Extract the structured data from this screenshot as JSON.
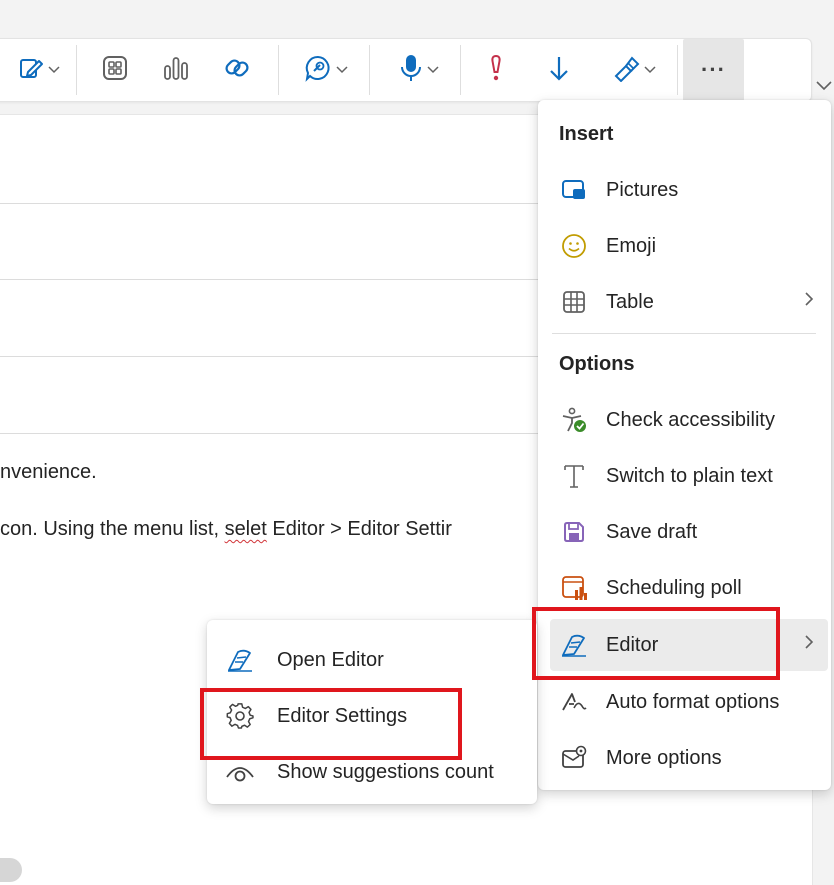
{
  "toolbar": {
    "buttons": [
      {
        "name": "format-painter",
        "icon": "pen-page-icon"
      },
      {
        "name": "apps",
        "icon": "apps-grid-icon"
      },
      {
        "name": "charts",
        "icon": "bar-chart-icon"
      },
      {
        "name": "loop",
        "icon": "loop-icon"
      },
      {
        "name": "copilot",
        "icon": "chat-copilot-icon"
      },
      {
        "name": "dictate",
        "icon": "microphone-icon"
      },
      {
        "name": "high-importance",
        "icon": "exclamation-icon"
      },
      {
        "name": "low-importance",
        "icon": "down-arrow-icon"
      },
      {
        "name": "sensitivity",
        "icon": "marker-icon"
      },
      {
        "name": "more",
        "icon": "ellipsis-icon"
      }
    ],
    "more_label": "···"
  },
  "document": {
    "line1": "nvenience.",
    "line2_before": "con. Using the menu list, ",
    "line2_misspelled": "selet",
    "line2_after": " Editor > Editor Settir"
  },
  "menu": {
    "insert_header": "Insert",
    "insert_items": [
      {
        "label": "Pictures",
        "icon": "picture-icon"
      },
      {
        "label": "Emoji",
        "icon": "emoji-icon"
      },
      {
        "label": "Table",
        "icon": "table-icon",
        "has_submenu": true
      }
    ],
    "options_header": "Options",
    "options_items": [
      {
        "label": "Check accessibility",
        "icon": "accessibility-icon"
      },
      {
        "label": "Switch to plain text",
        "icon": "plain-text-icon"
      },
      {
        "label": "Save draft",
        "icon": "save-icon"
      },
      {
        "label": "Scheduling poll",
        "icon": "scheduling-poll-icon"
      },
      {
        "label": "Editor",
        "icon": "editor-pen-icon",
        "has_submenu": true,
        "highlighted": true
      },
      {
        "label": "Auto format options",
        "icon": "auto-format-icon"
      },
      {
        "label": "More options",
        "icon": "more-options-icon"
      }
    ]
  },
  "submenu": {
    "items": [
      {
        "label": "Open Editor",
        "icon": "editor-pen-icon"
      },
      {
        "label": "Editor Settings",
        "icon": "gear-icon",
        "highlighted": true
      },
      {
        "label": "Show suggestions count",
        "icon": "eye-icon"
      }
    ]
  },
  "colors": {
    "accent": "#0f6cbd",
    "highlight_box": "#e0161d",
    "importance_red": "#c4314b",
    "accessibility_green": "#3b8c2a",
    "save_purple": "#8764b8",
    "poll_orange": "#ca5010",
    "emoji_tan": "#c19c00"
  }
}
